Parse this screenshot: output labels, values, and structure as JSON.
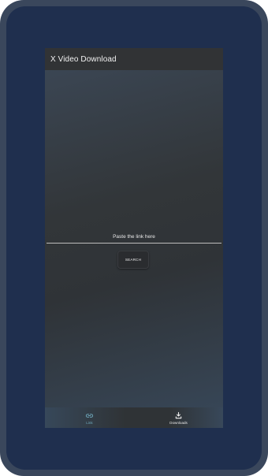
{
  "app_bar": {
    "title": "X Video Download"
  },
  "main": {
    "link_label": "Paste the link here",
    "link_input_value": "",
    "search_label": "SEARCH"
  },
  "bottom_nav": {
    "items": [
      {
        "label": "Link",
        "icon": "link-icon",
        "active": true
      },
      {
        "label": "Downloads",
        "icon": "download-icon",
        "active": false
      }
    ]
  },
  "colors": {
    "frame": "#3a475c",
    "background": "#1f2f4e",
    "app_bar": "#313335",
    "accent": "#6fa9bd"
  }
}
